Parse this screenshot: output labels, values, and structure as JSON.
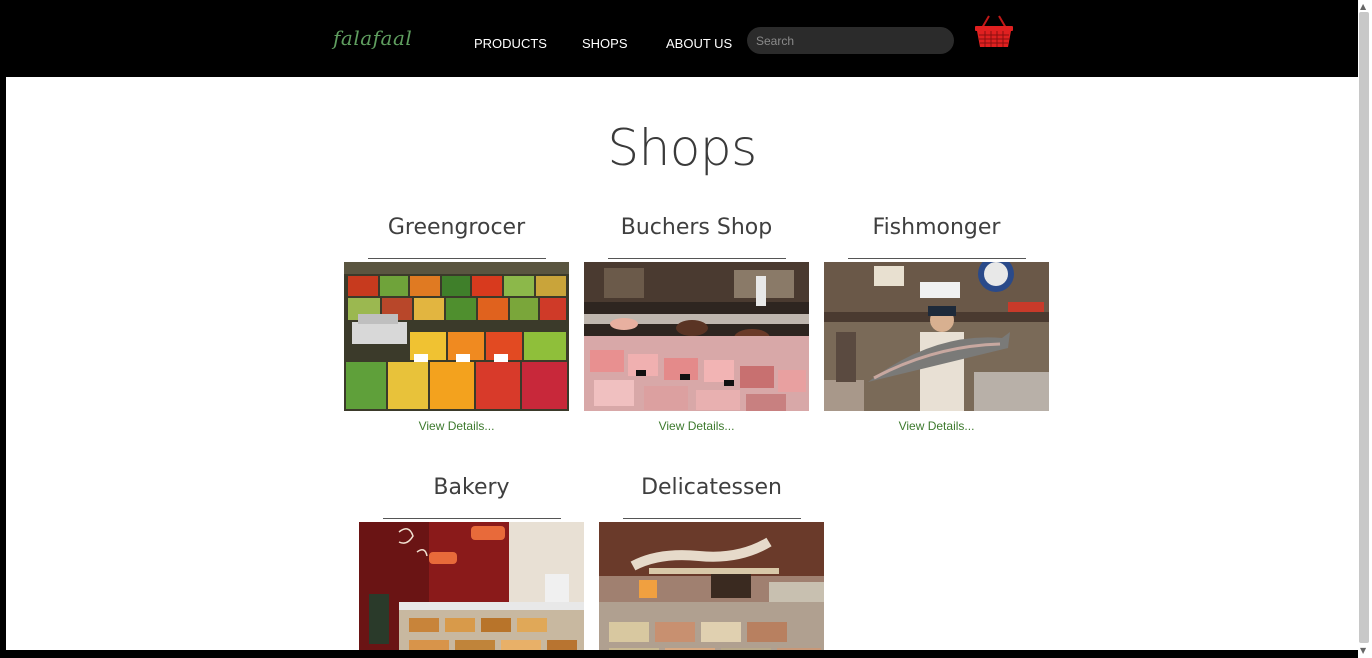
{
  "header": {
    "logo": "falafaal",
    "nav": [
      "PRODUCTS",
      "SHOPS",
      "ABOUT US"
    ],
    "search_placeholder": "Search",
    "cart_icon": "shopping-basket-icon",
    "cart_color": "#e02020"
  },
  "main": {
    "title": "Shops",
    "link_color": "#3d7a2e",
    "shops": [
      {
        "name": "Greengrocer",
        "link": "View Details..."
      },
      {
        "name": "Buchers Shop",
        "link": "View Details..."
      },
      {
        "name": "Fishmonger",
        "link": "View Details..."
      },
      {
        "name": "Bakery",
        "link": ""
      },
      {
        "name": "Delicatessen",
        "link": ""
      }
    ]
  }
}
